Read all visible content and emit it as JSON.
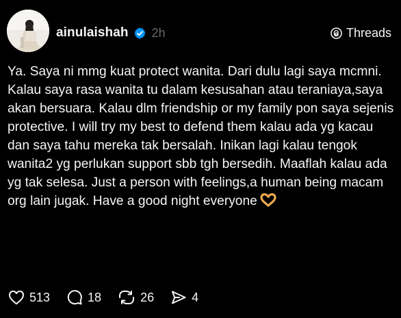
{
  "post": {
    "username": "ainulaishah",
    "timestamp": "2h",
    "verified": true,
    "text": "Ya. Saya ni mmg kuat protect wanita. Dari dulu lagi saya mcmni. Kalau saya rasa wanita tu dalam kesusahan atau teraniaya,saya akan bersuara. Kalau dlm friendship or my family pon saya sejenis protective. I will try my best to defend them kalau ada yg kacau dan saya tahu mereka tak bersalah. Inikan lagi kalau tengok wanita2 yg perlukan support sbb tgh bersedih. Maaflah kalau ada yg tak selesa. Just a person with feelings,a human being macam org lain jugak. Have a good night everyone",
    "emoji": "heart-hands-icon"
  },
  "brand": {
    "label": "Threads",
    "icon": "threads-logo-icon"
  },
  "actions": {
    "likes": "513",
    "replies": "18",
    "reposts": "26",
    "shares": "4"
  },
  "colors": {
    "background": "#000000",
    "text": "#f3f5f7",
    "muted": "#6b6b6b",
    "verified": "#0095f6"
  }
}
